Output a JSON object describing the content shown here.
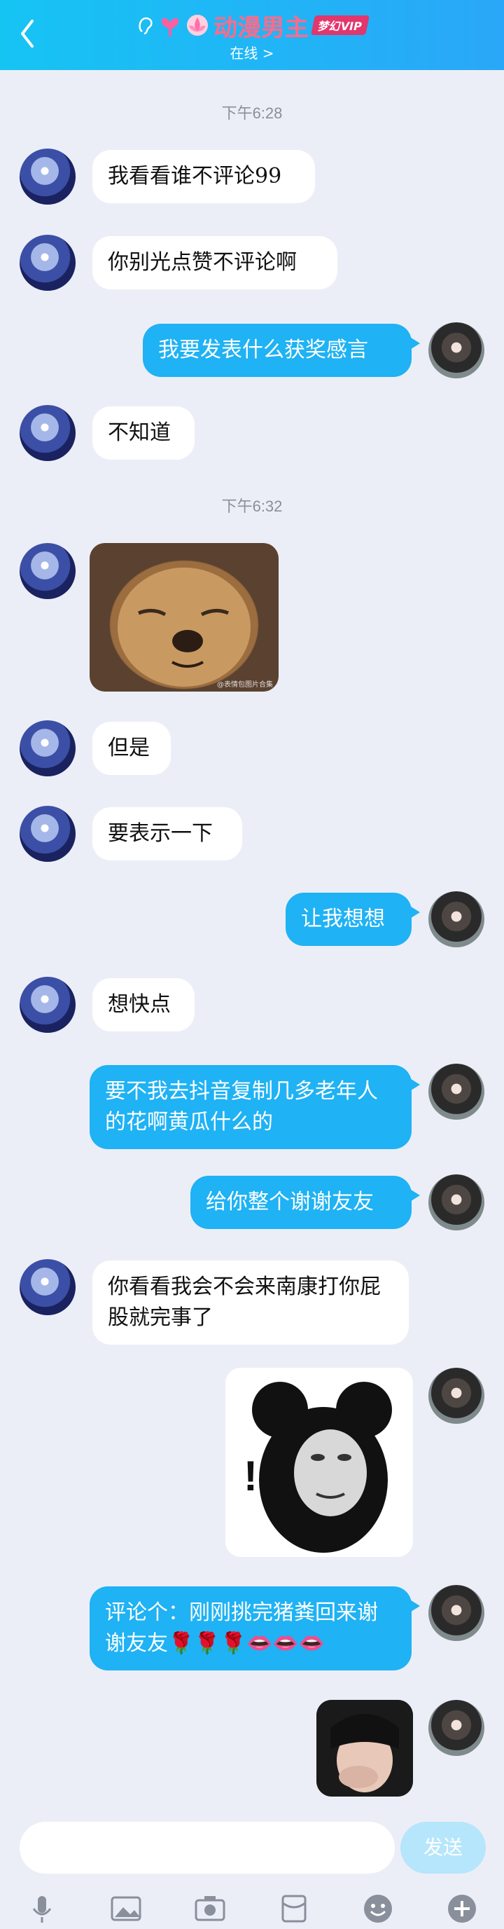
{
  "header": {
    "title": "动漫男主",
    "status": "在线 >",
    "badge_text": "梦幻VIP"
  },
  "messages": [
    {
      "type": "time",
      "text": "下午6:28"
    },
    {
      "type": "text",
      "side": "left",
      "text": "我看看谁不评论99"
    },
    {
      "type": "text",
      "side": "left",
      "text": "你别光点赞不评论啊"
    },
    {
      "type": "text",
      "side": "right",
      "text": "我要发表什么获奖感言"
    },
    {
      "type": "text",
      "side": "left",
      "text": "不知道"
    },
    {
      "type": "time",
      "text": "下午6:32"
    },
    {
      "type": "image",
      "side": "left",
      "name": "squinting-dog-sticker",
      "caption": "@表情包图片合集"
    },
    {
      "type": "text",
      "side": "left",
      "text": "但是"
    },
    {
      "type": "text",
      "side": "left",
      "text": "要表示一下"
    },
    {
      "type": "text",
      "side": "right",
      "text": "让我想想"
    },
    {
      "type": "text",
      "side": "left",
      "text": "想快点"
    },
    {
      "type": "text",
      "side": "right",
      "text": "要不我去抖音复制几多老年人的花啊黄瓜什么的"
    },
    {
      "type": "text",
      "side": "right",
      "text": "给你整个谢谢友友"
    },
    {
      "type": "text",
      "side": "left",
      "text": "你看看我会不会来南康打你屁股就完事了"
    },
    {
      "type": "image",
      "side": "right",
      "name": "panda-meme-sticker",
      "caption": "!"
    },
    {
      "type": "text",
      "side": "right",
      "text": "评论个：刚刚挑完猪粪回来谢谢友友🌹🌹🌹👄👄👄"
    },
    {
      "type": "image",
      "side": "right",
      "name": "covering-face-sticker"
    }
  ],
  "input": {
    "placeholder": "",
    "send_label": "发送"
  },
  "toolbar": [
    "voice-icon",
    "image-icon",
    "camera-icon",
    "red-packet-icon",
    "emoji-icon",
    "plus-icon"
  ],
  "colors": {
    "header_start": "#16c4f4",
    "header_end": "#2aa7f8",
    "bubble_right": "#1fb2f4",
    "bubble_left": "#ffffff",
    "background": "#eceef7",
    "title": "#ff6b8a"
  }
}
